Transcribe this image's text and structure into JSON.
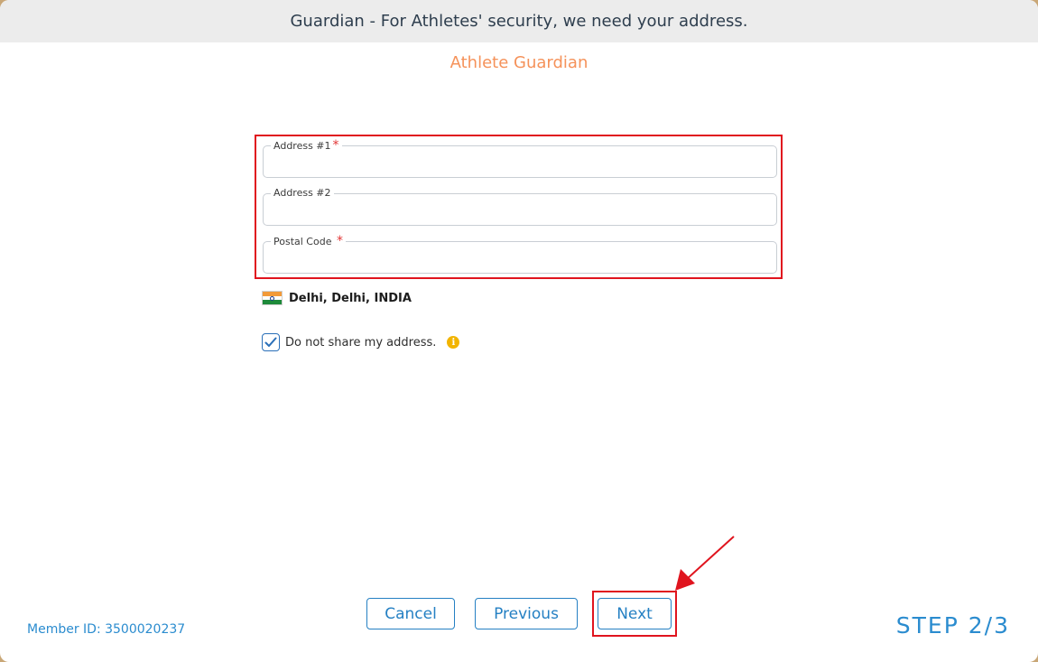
{
  "header": {
    "title": "Guardian - For Athletes' security, we need your address."
  },
  "subtitle": "Athlete Guardian",
  "fields": [
    {
      "label": "Address #1",
      "required": true,
      "value": "",
      "placeholder": ""
    },
    {
      "label": "Address #2",
      "required": false,
      "value": "",
      "placeholder": ""
    },
    {
      "label": "Postal Code",
      "required": true,
      "value": "",
      "placeholder": ""
    }
  ],
  "required_mark": "*",
  "location": {
    "text": "Delhi, Delhi, INDIA",
    "flag_icon": "india-flag-icon"
  },
  "share": {
    "label": "Do not share my address.",
    "checked": true,
    "info_icon": "info-icon"
  },
  "buttons": {
    "cancel": "Cancel",
    "previous": "Previous",
    "next": "Next"
  },
  "footer": {
    "member_id": "Member ID: 3500020237",
    "step": "STEP 2/3"
  },
  "colors": {
    "accent": "#2580c3",
    "subtitle": "#f5925a",
    "highlight": "#e0141e",
    "required": "#e23636",
    "info": "#f2b400"
  }
}
